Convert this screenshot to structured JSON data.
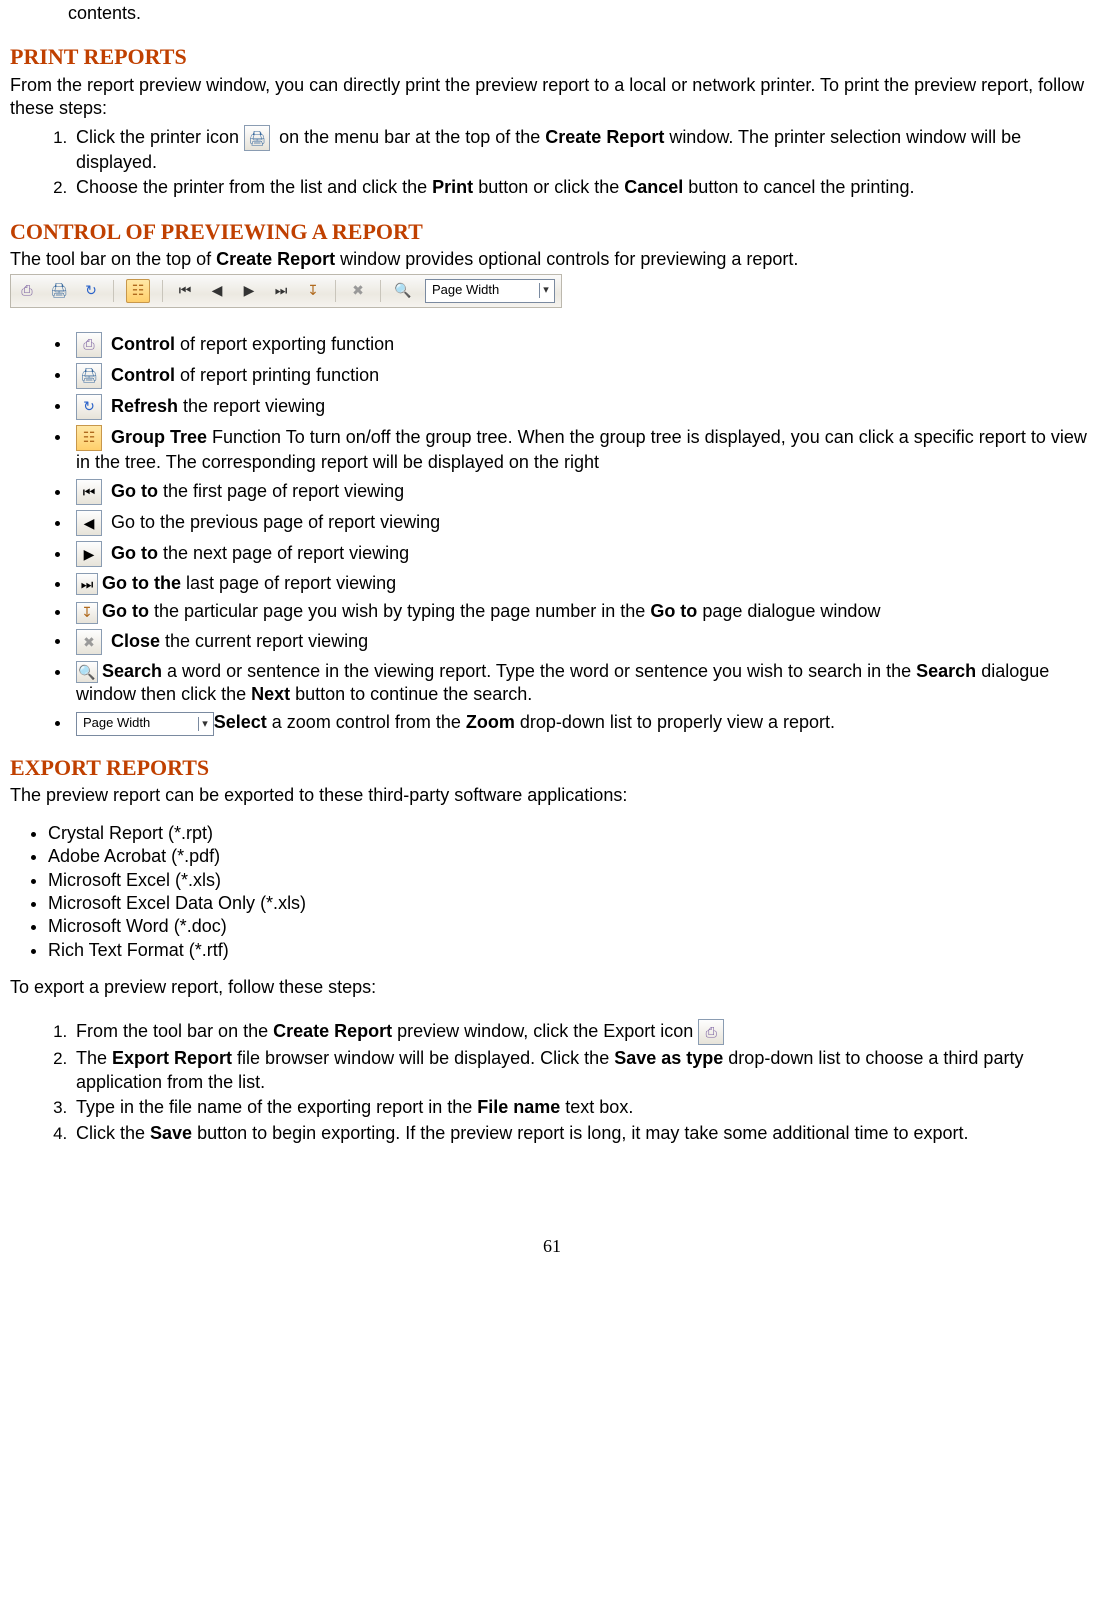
{
  "top_fragment": "contents.",
  "print_reports": {
    "heading": "PRINT REPORTS",
    "intro": "From the report preview window, you can directly print the preview report to a local or network printer. To print the preview report, follow these steps:",
    "step1_a": "Click the printer icon ",
    "step1_b": "on the menu bar at the top of the ",
    "step1_c": "Create Report",
    "step1_d": " window.    The printer selection window will be displayed.",
    "step2_a": "Choose the printer from the list and click the ",
    "step2_b": "Print",
    "step2_c": " button or click the ",
    "step2_d": "Cancel",
    "step2_e": " button to cancel the printing."
  },
  "control_preview": {
    "heading": "CONTROL OF PREVIEWING A REPORT",
    "intro_a": "The tool bar on the top of ",
    "intro_b": "Create Report",
    "intro_c": " window provides optional controls for previewing a report.",
    "zoom_label": "Page Width",
    "items": {
      "export": {
        "bold": " Control",
        "rest": " of report exporting function"
      },
      "print": {
        "bold": " Control",
        "rest": " of report printing function"
      },
      "refresh": {
        "bold": "  Refresh",
        "rest": " the report viewing"
      },
      "grouptree": {
        "bold": " Group Tree",
        "rest": " Function To turn on/off the group tree. When the group tree is displayed, you can click a specific report to view in the tree. The corresponding report will be displayed on the right"
      },
      "first": {
        "bold": "  Go to",
        "rest": " the first page of report viewing"
      },
      "prev": {
        "bold": "",
        "rest": "  Go to the previous page of report viewing"
      },
      "next": {
        "bold": "  Go to",
        "rest": " the next page of report viewing"
      },
      "last": {
        "bold": "Go to the",
        "rest": " last page of report viewing"
      },
      "goto_a": {
        "bold": "Go to",
        "rest": " the particular page you wish by typing the page number in the "
      },
      "goto_b": {
        "bold": "Go to",
        "rest": " page dialogue window"
      },
      "close": {
        "bold": "   Close",
        "rest": " the current report viewing"
      },
      "search_a": {
        "bold": "Search",
        "rest": " a word or sentence in the viewing report. Type the word or sentence you wish to search in the "
      },
      "search_b": {
        "bold": "Search",
        "rest": " dialogue window then click the "
      },
      "search_c": {
        "bold": "Next",
        "rest": " button to continue the search."
      },
      "zoom_a": {
        "bold": "Select",
        "rest": " a zoom control from the "
      },
      "zoom_b": {
        "bold": "Zoom",
        "rest": " drop-down list to properly view a report."
      }
    }
  },
  "export_reports": {
    "heading": "EXPORT REPORTS",
    "intro": "The preview report can be exported to these third-party software applications:",
    "formats": [
      "Crystal Report (*.rpt)",
      "Adobe Acrobat (*.pdf)",
      "Microsoft Excel (*.xls)",
      "Microsoft Excel Data Only (*.xls)",
      "Microsoft Word (*.doc)",
      "Rich Text Format (*.rtf)"
    ],
    "steps_intro": "To export a preview report, follow these steps:",
    "step1_a": "From the tool bar on the ",
    "step1_b": "Create Report",
    "step1_c": " preview window, click the Export icon ",
    "step2_a": "The ",
    "step2_b": "Export Report",
    "step2_c": " file browser window will be displayed. Click the ",
    "step2_d": "Save as type",
    "step2_e": " drop-down list to choose a third party application from the list.",
    "step3_a": "Type in the file name of the exporting report in the ",
    "step3_b": "File name",
    "step3_c": " text box.",
    "step4_a": "Click the ",
    "step4_b": "Save",
    "step4_c": " button to begin exporting. If the preview report is long, it may take some additional time to export."
  },
  "page_number": "61"
}
